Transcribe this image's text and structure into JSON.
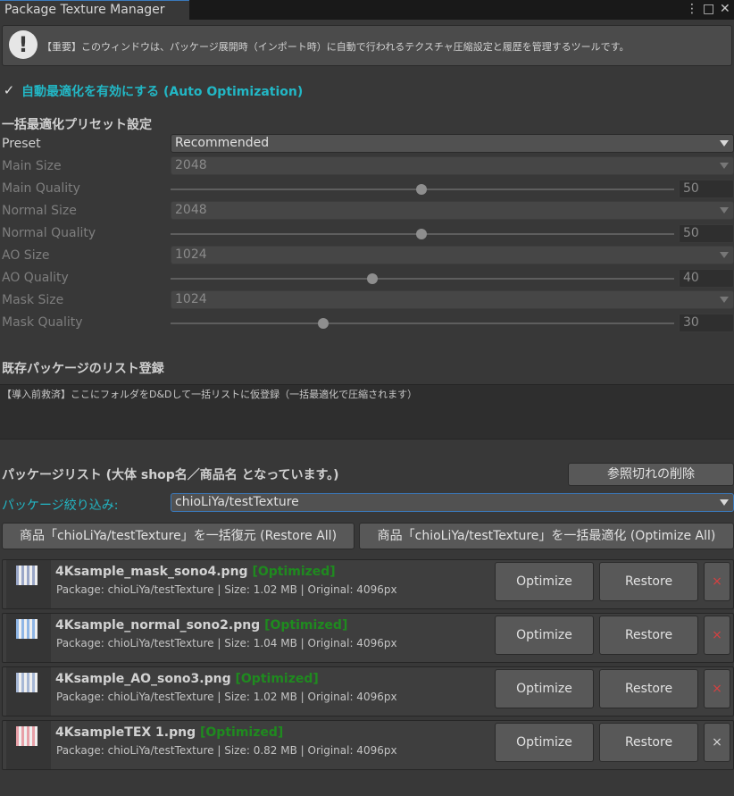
{
  "window": {
    "title": "Package Texture Manager",
    "menu_icon": "⋮",
    "maximize_icon": "□",
    "close_icon": "✕"
  },
  "info": {
    "icon": "!",
    "text": "【重要】このウィンドウは、パッケージ展開時（インポート時）に自動で行われるテクスチャ圧縮設定と履歴を管理するツールです。"
  },
  "auto_optimization": {
    "checked": true,
    "check_glyph": "✓",
    "label": "自動最適化を有効にする (Auto Optimization)"
  },
  "preset_section": {
    "heading": "一括最適化プリセット設定",
    "preset": {
      "label": "Preset",
      "value": "Recommended"
    },
    "main_size": {
      "label": "Main Size",
      "value": "2048"
    },
    "main_quality": {
      "label": "Main Quality",
      "value": "50"
    },
    "normal_size": {
      "label": "Normal Size",
      "value": "2048"
    },
    "normal_quality": {
      "label": "Normal Quality",
      "value": "50"
    },
    "ao_size": {
      "label": "AO Size",
      "value": "1024"
    },
    "ao_quality": {
      "label": "AO Quality",
      "value": "40"
    },
    "mask_size": {
      "label": "Mask Size",
      "value": "1024"
    },
    "mask_quality": {
      "label": "Mask Quality",
      "value": "30"
    }
  },
  "register_section": {
    "heading": "既存パッケージのリスト登録",
    "drop_text": "【導入前救済】ここにフォルダをD&Dして一括リストに仮登録（一括最適化で圧縮されます）"
  },
  "package_list": {
    "heading": "パッケージリスト (大体 shop名／商品名 となっています。)",
    "remove_missing_button": "参照切れの削除",
    "filter_label": "パッケージ絞り込み:",
    "filter_value": "chioLiYa/testTexture",
    "restore_all_button": "商品「chioLiYa/testTexture」を一括復元 (Restore All)",
    "optimize_all_button": "商品「chioLiYa/testTexture」を一括最適化 (Optimize All)"
  },
  "items": [
    {
      "name": "4Ksample_mask_sono4.png",
      "status": "[Optimized]",
      "info": "Package: chioLiYa/testTexture | Size: 1.02 MB | Original: 4096px",
      "optimize": "Optimize",
      "restore": "Restore",
      "delete": "×",
      "thumb_color": "#9aa7c8"
    },
    {
      "name": "4Ksample_normal_sono2.png",
      "status": "[Optimized]",
      "info": "Package: chioLiYa/testTexture | Size: 1.04 MB | Original: 4096px",
      "optimize": "Optimize",
      "restore": "Restore",
      "delete": "×",
      "thumb_color": "#8fb6e6"
    },
    {
      "name": "4Ksample_AO_sono3.png",
      "status": "[Optimized]",
      "info": "Package: chioLiYa/testTexture | Size: 1.02 MB | Original: 4096px",
      "optimize": "Optimize",
      "restore": "Restore",
      "delete": "×",
      "thumb_color": "#a7b8d6"
    },
    {
      "name": "4KsampleTEX 1.png",
      "status": "[Optimized]",
      "info": "Package: chioLiYa/testTexture | Size: 0.82 MB | Original: 4096px",
      "optimize": "Optimize",
      "restore": "Restore",
      "delete": "×",
      "thumb_color": "#e8a0a8"
    }
  ],
  "colors": {
    "accent": "#22b7c5",
    "optimized": "#1f8a1f",
    "delete": "#d64040"
  }
}
